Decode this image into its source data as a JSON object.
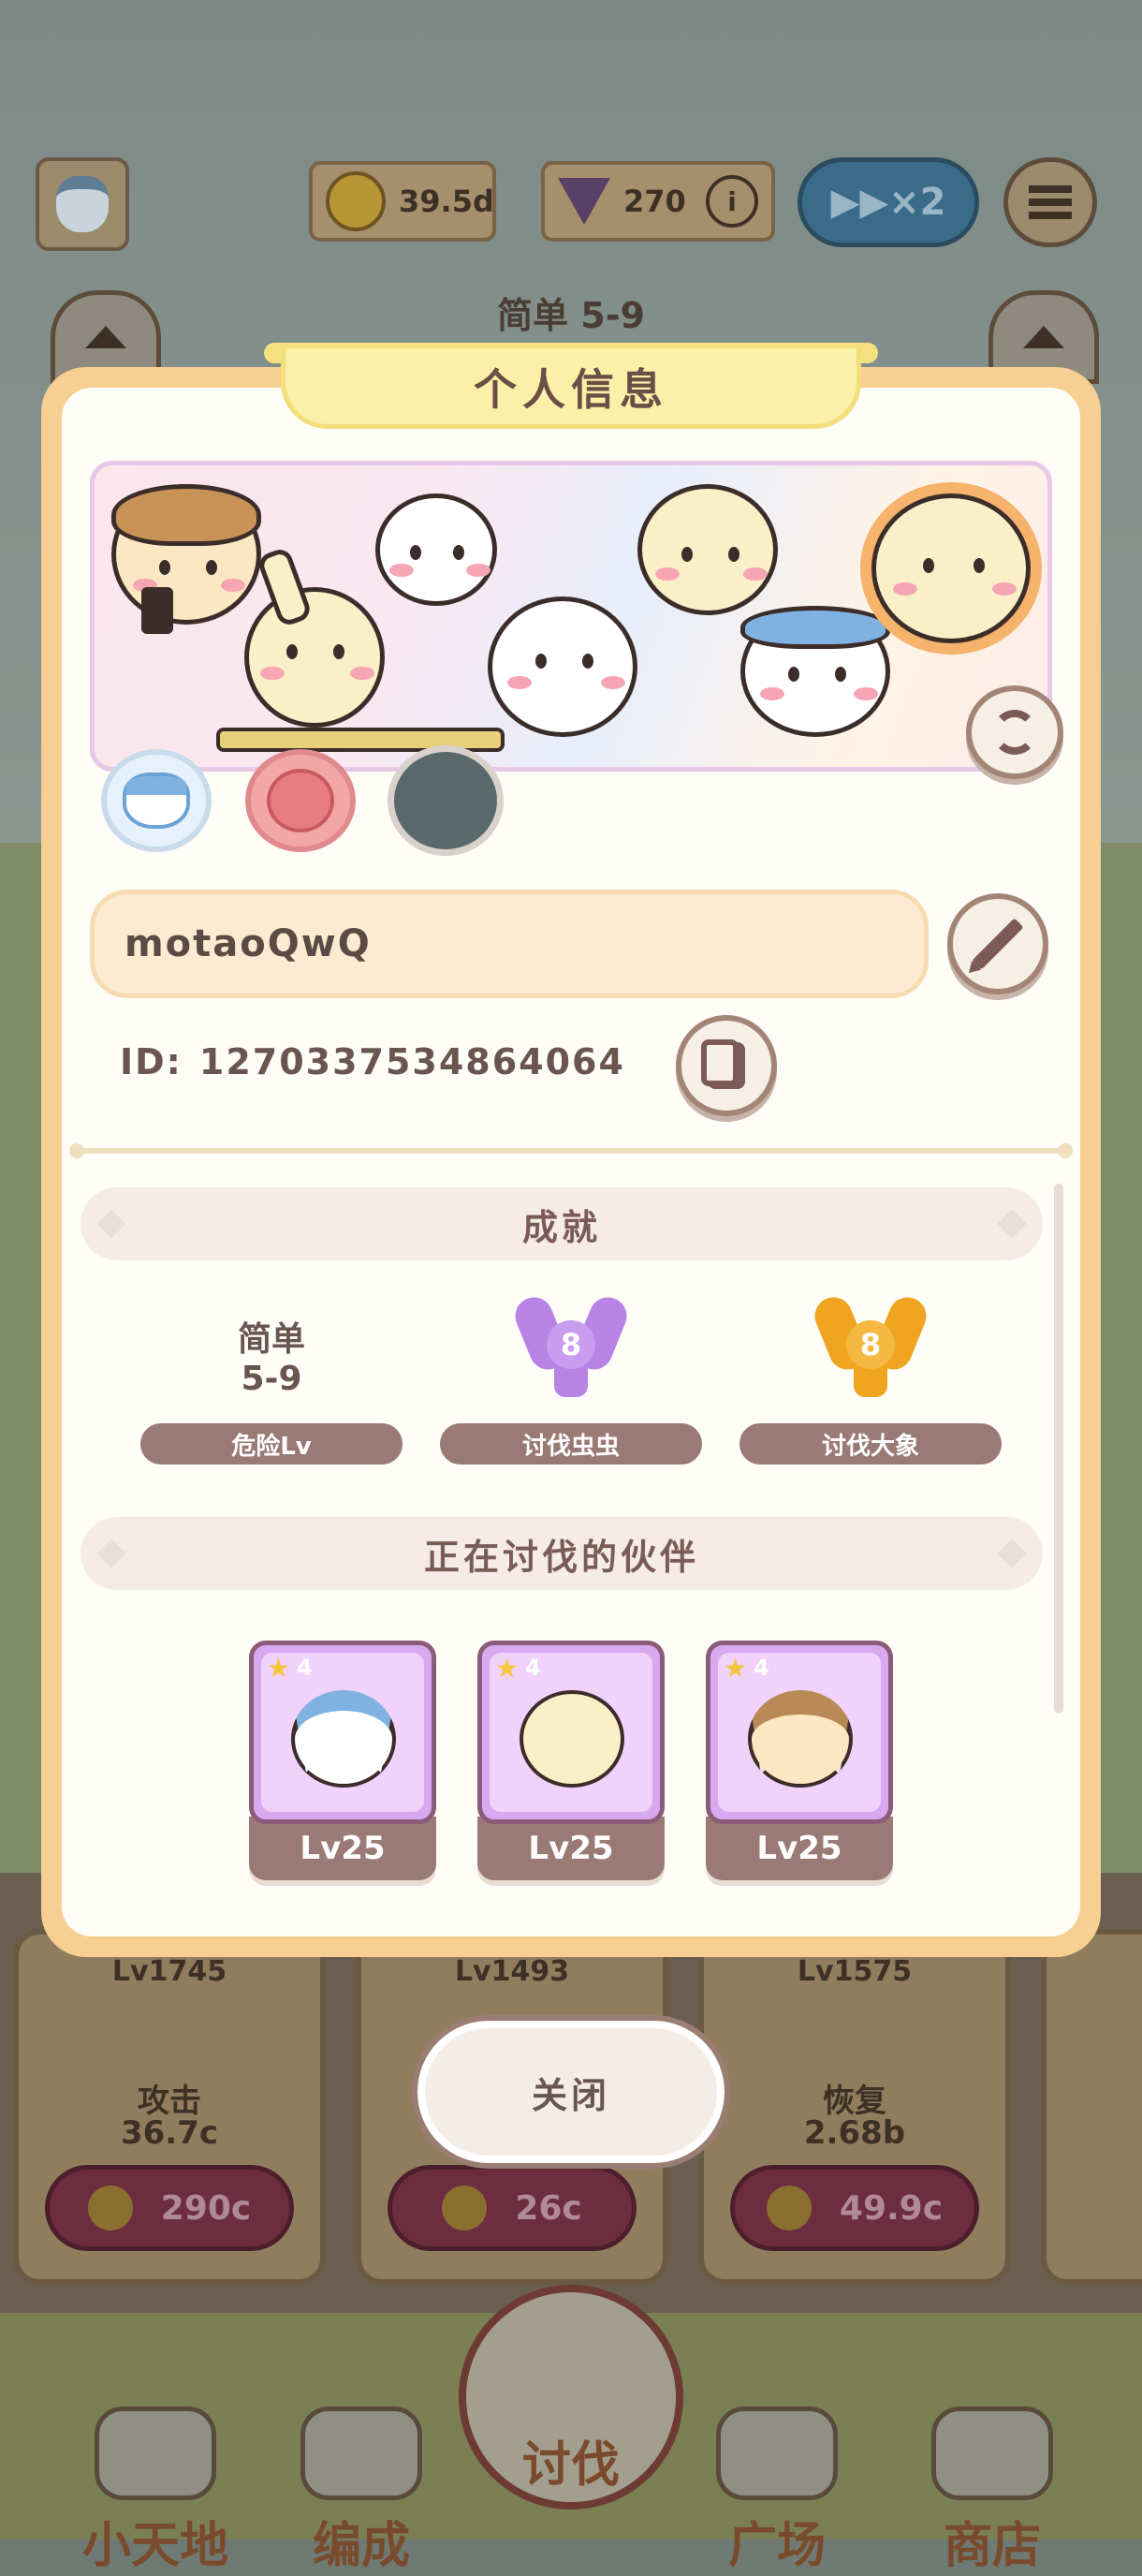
{
  "hud": {
    "coins": "39.5d",
    "gems": "270",
    "speed_label": "▶▶×2"
  },
  "stage": {
    "label": "简单 5-9"
  },
  "modal": {
    "title": "个人信息",
    "player_name": "motaoQwQ",
    "id_label": "ID:",
    "id_value": "1270337534864064",
    "achievements_title": "成就",
    "achievements": [
      {
        "display_line1": "简单",
        "display_line2": "5-9",
        "label": "危险Lv"
      },
      {
        "display_value": "8",
        "label": "讨伐虫虫",
        "color": "#b784e6"
      },
      {
        "display_value": "8",
        "label": "讨伐大象",
        "color": "#f0a520"
      }
    ],
    "partners_title": "正在讨伐的伙伴",
    "partners": [
      {
        "stars": "4",
        "level": "Lv25",
        "character": "cat-with-fork"
      },
      {
        "stars": "4",
        "level": "Lv25",
        "character": "rabbit-with-pole"
      },
      {
        "stars": "4",
        "level": "Lv25",
        "character": "hamster-with-can"
      }
    ],
    "close_label": "关闭"
  },
  "upgrades": [
    {
      "level": "Lv1745",
      "name": "攻击",
      "value": "36.7c",
      "cost": "290c"
    },
    {
      "level": "Lv1493",
      "name": "",
      "value": "",
      "cost": "26c"
    },
    {
      "level": "Lv1575",
      "name": "恢复",
      "value": "2.68b",
      "cost": "49.9c"
    }
  ],
  "nav": {
    "items": [
      "小天地",
      "编成",
      "讨伐",
      "广场",
      "商店"
    ]
  },
  "colors": {
    "modal_border": "#f7cf92",
    "title_bg": "#fbf0a8",
    "pill_bg": "#9a7a74",
    "partner_frame": "#d9a9f0"
  }
}
